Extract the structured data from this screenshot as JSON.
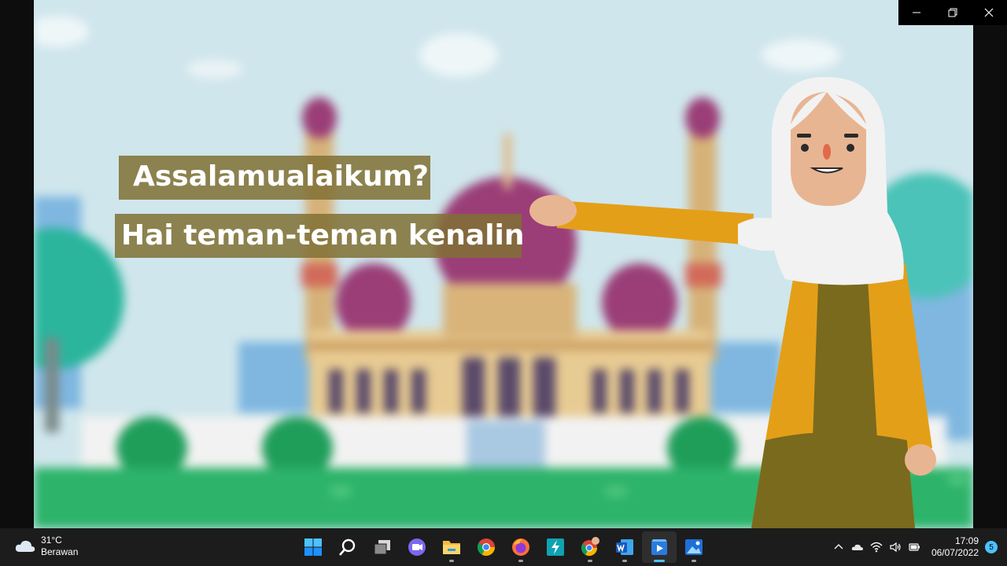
{
  "video": {
    "caption_1": "Assalamualaikum?",
    "caption_2": "Hai teman-teman kenalin"
  },
  "window_controls": [
    "minimize-icon",
    "restore-icon",
    "close-icon"
  ],
  "taskbar": {
    "weather": {
      "temperature": "31°C",
      "condition": "Berawan",
      "icon": "cloud-icon"
    },
    "apps": [
      {
        "name": "start",
        "icon": "windows-start-icon"
      },
      {
        "name": "search",
        "icon": "search-icon"
      },
      {
        "name": "task-view",
        "icon": "task-view-icon"
      },
      {
        "name": "teams-chat",
        "icon": "chat-icon"
      },
      {
        "name": "file-explorer",
        "icon": "folder-icon",
        "running": true
      },
      {
        "name": "chrome",
        "icon": "chrome-icon"
      },
      {
        "name": "firefox",
        "icon": "firefox-icon",
        "running": true
      },
      {
        "name": "power-automate",
        "icon": "lightning-icon"
      },
      {
        "name": "chrome-profile",
        "icon": "chrome-profile-icon",
        "running": true
      },
      {
        "name": "word",
        "icon": "word-icon",
        "running": true
      },
      {
        "name": "media-player",
        "icon": "media-player-icon",
        "running": true,
        "active": true
      },
      {
        "name": "photos",
        "icon": "photos-icon",
        "running": true
      }
    ],
    "tray": [
      "chevron-up-icon",
      "onedrive-icon",
      "wifi-icon",
      "volume-icon",
      "battery-icon"
    ],
    "clock": {
      "time": "17:09",
      "date": "06/07/2022"
    },
    "notifications": "5"
  },
  "colors": {
    "caption_bg": "#807034",
    "accent": "#4cc2ff",
    "taskbar_bg": "#1c1c1c"
  }
}
